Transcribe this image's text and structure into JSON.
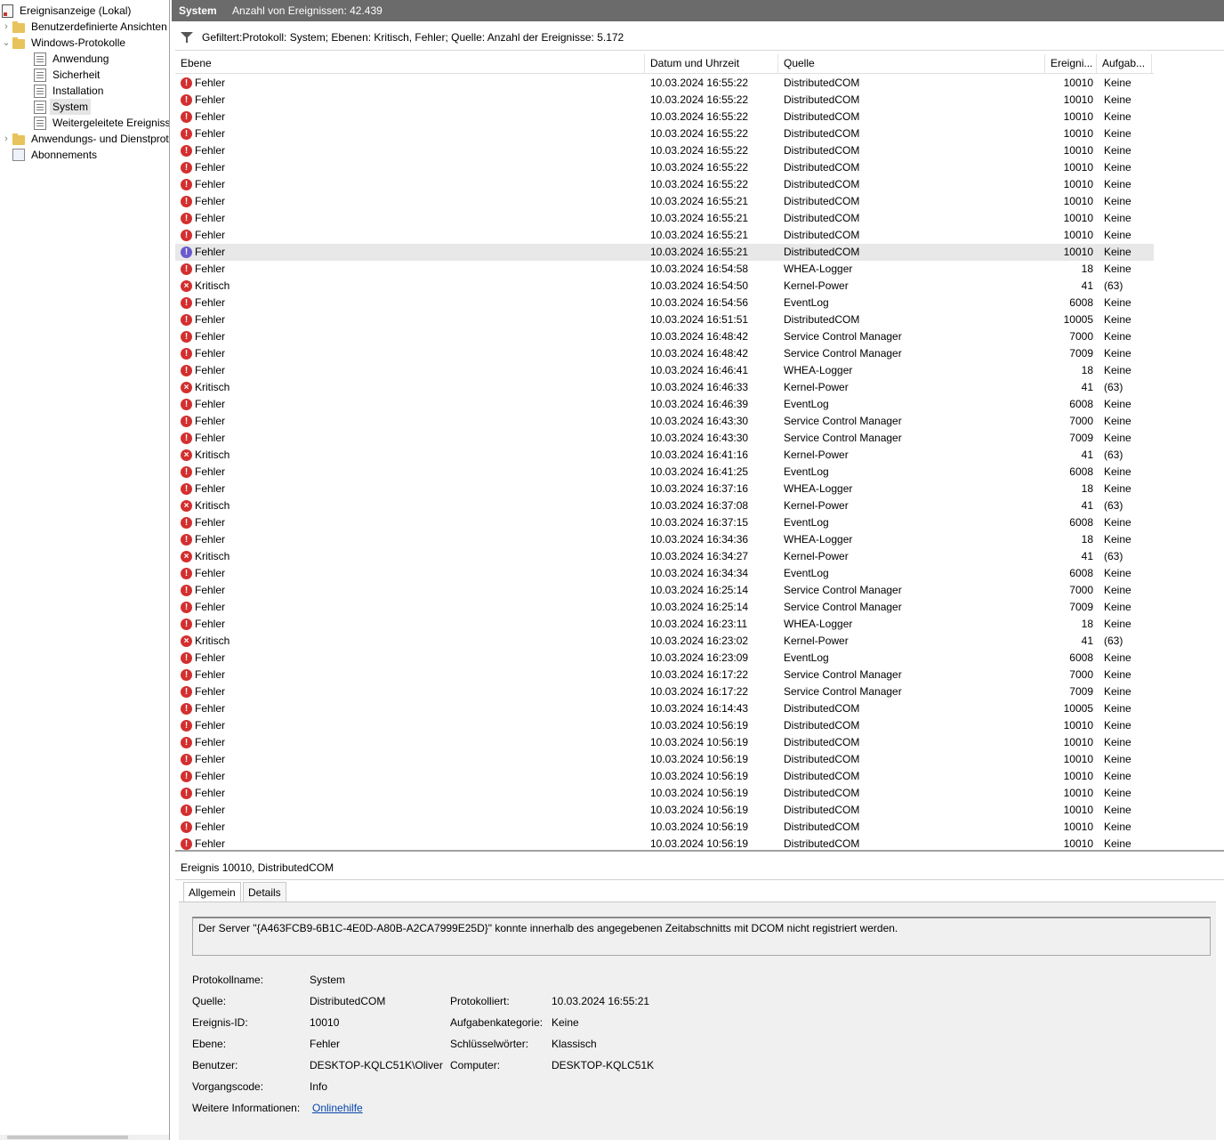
{
  "tree": {
    "root": "Ereignisanzeige (Lokal)",
    "custom_views": "Benutzerdefinierte Ansichten",
    "windows_logs": "Windows-Protokolle",
    "app_log": "Anwendung",
    "security_log": "Sicherheit",
    "setup_log": "Installation",
    "system_log": "System",
    "forwarded_log": "Weitergeleitete Ereignisse",
    "app_services": "Anwendungs- und Dienstprotokolle",
    "subscriptions": "Abonnements"
  },
  "header": {
    "name": "System",
    "count": "Anzahl von Ereignissen: 42.439"
  },
  "filter": {
    "text": "Gefiltert:Protokoll: System; Ebenen: Kritisch, Fehler; Quelle:  Anzahl der Ereignisse: 5.172"
  },
  "columns": {
    "level": "Ebene",
    "date": "Datum und Uhrzeit",
    "source": "Quelle",
    "id": "Ereigni...",
    "task": "Aufgab..."
  },
  "rows": [
    [
      "Fehler",
      "10.03.2024 16:55:22",
      "DistributedCOM",
      "10010",
      "Keine"
    ],
    [
      "Fehler",
      "10.03.2024 16:55:22",
      "DistributedCOM",
      "10010",
      "Keine"
    ],
    [
      "Fehler",
      "10.03.2024 16:55:22",
      "DistributedCOM",
      "10010",
      "Keine"
    ],
    [
      "Fehler",
      "10.03.2024 16:55:22",
      "DistributedCOM",
      "10010",
      "Keine"
    ],
    [
      "Fehler",
      "10.03.2024 16:55:22",
      "DistributedCOM",
      "10010",
      "Keine"
    ],
    [
      "Fehler",
      "10.03.2024 16:55:22",
      "DistributedCOM",
      "10010",
      "Keine"
    ],
    [
      "Fehler",
      "10.03.2024 16:55:22",
      "DistributedCOM",
      "10010",
      "Keine"
    ],
    [
      "Fehler",
      "10.03.2024 16:55:21",
      "DistributedCOM",
      "10010",
      "Keine"
    ],
    [
      "Fehler",
      "10.03.2024 16:55:21",
      "DistributedCOM",
      "10010",
      "Keine"
    ],
    [
      "Fehler",
      "10.03.2024 16:55:21",
      "DistributedCOM",
      "10010",
      "Keine"
    ],
    [
      "Fehler",
      "10.03.2024 16:55:21",
      "DistributedCOM",
      "10010",
      "Keine"
    ],
    [
      "Fehler",
      "10.03.2024 16:54:58",
      "WHEA-Logger",
      "18",
      "Keine"
    ],
    [
      "Kritisch",
      "10.03.2024 16:54:50",
      "Kernel-Power",
      "41",
      "(63)"
    ],
    [
      "Fehler",
      "10.03.2024 16:54:56",
      "EventLog",
      "6008",
      "Keine"
    ],
    [
      "Fehler",
      "10.03.2024 16:51:51",
      "DistributedCOM",
      "10005",
      "Keine"
    ],
    [
      "Fehler",
      "10.03.2024 16:48:42",
      "Service Control Manager",
      "7000",
      "Keine"
    ],
    [
      "Fehler",
      "10.03.2024 16:48:42",
      "Service Control Manager",
      "7009",
      "Keine"
    ],
    [
      "Fehler",
      "10.03.2024 16:46:41",
      "WHEA-Logger",
      "18",
      "Keine"
    ],
    [
      "Kritisch",
      "10.03.2024 16:46:33",
      "Kernel-Power",
      "41",
      "(63)"
    ],
    [
      "Fehler",
      "10.03.2024 16:46:39",
      "EventLog",
      "6008",
      "Keine"
    ],
    [
      "Fehler",
      "10.03.2024 16:43:30",
      "Service Control Manager",
      "7000",
      "Keine"
    ],
    [
      "Fehler",
      "10.03.2024 16:43:30",
      "Service Control Manager",
      "7009",
      "Keine"
    ],
    [
      "Kritisch",
      "10.03.2024 16:41:16",
      "Kernel-Power",
      "41",
      "(63)"
    ],
    [
      "Fehler",
      "10.03.2024 16:41:25",
      "EventLog",
      "6008",
      "Keine"
    ],
    [
      "Fehler",
      "10.03.2024 16:37:16",
      "WHEA-Logger",
      "18",
      "Keine"
    ],
    [
      "Kritisch",
      "10.03.2024 16:37:08",
      "Kernel-Power",
      "41",
      "(63)"
    ],
    [
      "Fehler",
      "10.03.2024 16:37:15",
      "EventLog",
      "6008",
      "Keine"
    ],
    [
      "Fehler",
      "10.03.2024 16:34:36",
      "WHEA-Logger",
      "18",
      "Keine"
    ],
    [
      "Kritisch",
      "10.03.2024 16:34:27",
      "Kernel-Power",
      "41",
      "(63)"
    ],
    [
      "Fehler",
      "10.03.2024 16:34:34",
      "EventLog",
      "6008",
      "Keine"
    ],
    [
      "Fehler",
      "10.03.2024 16:25:14",
      "Service Control Manager",
      "7000",
      "Keine"
    ],
    [
      "Fehler",
      "10.03.2024 16:25:14",
      "Service Control Manager",
      "7009",
      "Keine"
    ],
    [
      "Fehler",
      "10.03.2024 16:23:11",
      "WHEA-Logger",
      "18",
      "Keine"
    ],
    [
      "Kritisch",
      "10.03.2024 16:23:02",
      "Kernel-Power",
      "41",
      "(63)"
    ],
    [
      "Fehler",
      "10.03.2024 16:23:09",
      "EventLog",
      "6008",
      "Keine"
    ],
    [
      "Fehler",
      "10.03.2024 16:17:22",
      "Service Control Manager",
      "7000",
      "Keine"
    ],
    [
      "Fehler",
      "10.03.2024 16:17:22",
      "Service Control Manager",
      "7009",
      "Keine"
    ],
    [
      "Fehler",
      "10.03.2024 16:14:43",
      "DistributedCOM",
      "10005",
      "Keine"
    ],
    [
      "Fehler",
      "10.03.2024 10:56:19",
      "DistributedCOM",
      "10010",
      "Keine"
    ],
    [
      "Fehler",
      "10.03.2024 10:56:19",
      "DistributedCOM",
      "10010",
      "Keine"
    ],
    [
      "Fehler",
      "10.03.2024 10:56:19",
      "DistributedCOM",
      "10010",
      "Keine"
    ],
    [
      "Fehler",
      "10.03.2024 10:56:19",
      "DistributedCOM",
      "10010",
      "Keine"
    ],
    [
      "Fehler",
      "10.03.2024 10:56:19",
      "DistributedCOM",
      "10010",
      "Keine"
    ],
    [
      "Fehler",
      "10.03.2024 10:56:19",
      "DistributedCOM",
      "10010",
      "Keine"
    ],
    [
      "Fehler",
      "10.03.2024 10:56:19",
      "DistributedCOM",
      "10010",
      "Keine"
    ],
    [
      "Fehler",
      "10.03.2024 10:56:19",
      "DistributedCOM",
      "10010",
      "Keine"
    ]
  ],
  "selected_row": 10,
  "detail": {
    "title": "Ereignis 10010, DistributedCOM",
    "tab_general": "Allgemein",
    "tab_details": "Details",
    "message": "Der Server \"{A463FCB9-6B1C-4E0D-A80B-A2CA7999E25D}\" konnte innerhalb des angegebenen Zeitabschnitts mit DCOM nicht registriert werden.",
    "labels": {
      "log_name": "Protokollname:",
      "source": "Quelle:",
      "event_id": "Ereignis-ID:",
      "level": "Ebene:",
      "user": "Benutzer:",
      "opcode": "Vorgangscode:",
      "more_info": "Weitere Informationen:",
      "logged": "Protokolliert:",
      "task_category": "Aufgabenkategorie:",
      "keywords": "Schlüsselwörter:",
      "computer": "Computer:"
    },
    "values": {
      "log_name": "System",
      "source": "DistributedCOM",
      "event_id": "10010",
      "level": "Fehler",
      "user": "DESKTOP-KQLC51K\\Oliver",
      "opcode": "Info",
      "more_info_link": "Onlinehilfe",
      "logged": "10.03.2024 16:55:21",
      "task_category": "Keine",
      "keywords": "Klassisch",
      "computer": "DESKTOP-KQLC51K"
    }
  }
}
